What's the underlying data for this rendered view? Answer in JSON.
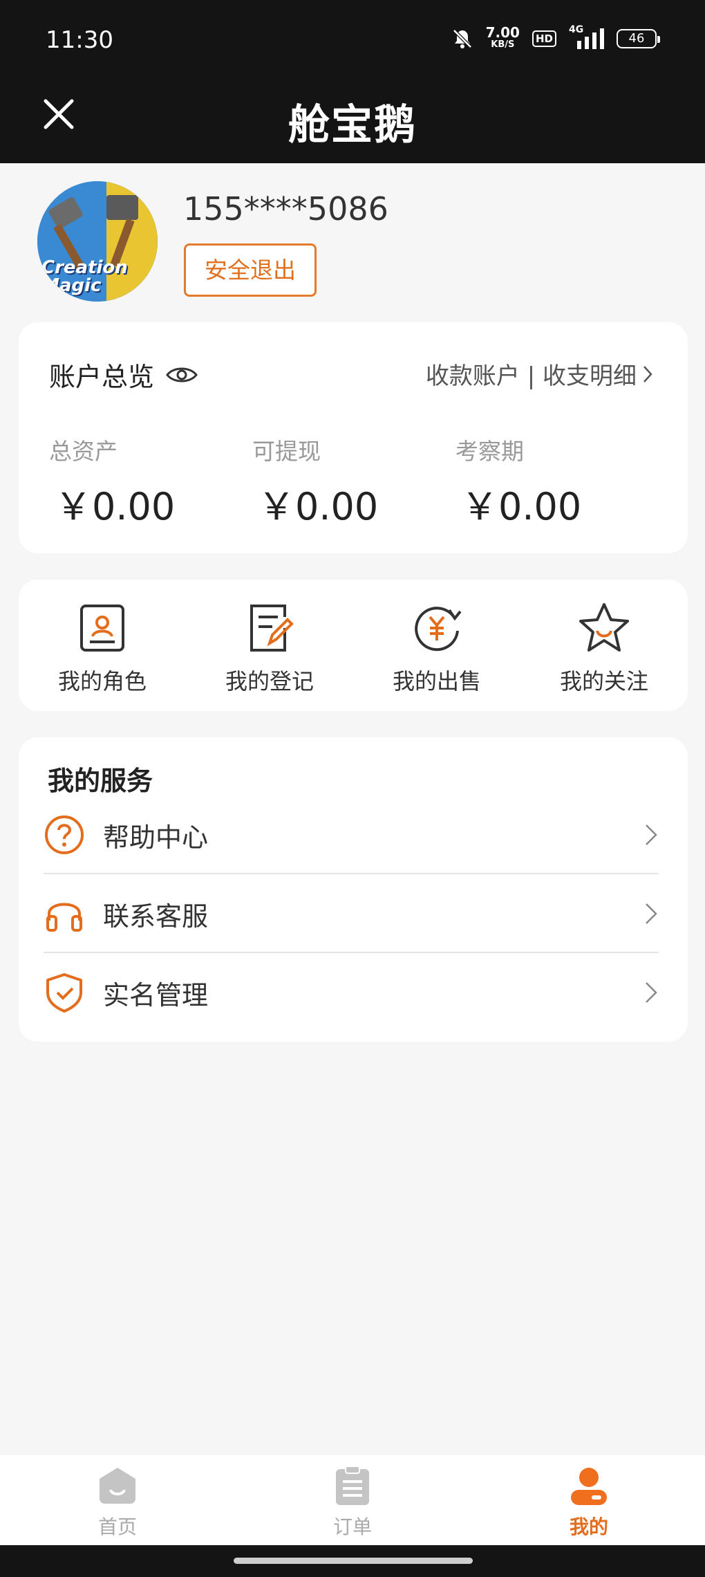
{
  "status_bar": {
    "time": "11:30",
    "net_speed": "7.00",
    "net_unit": "KB/S",
    "hd": "HD",
    "network": "4G",
    "battery": "46"
  },
  "header": {
    "title": "舱宝鹅",
    "close_icon": "close-icon"
  },
  "profile": {
    "avatar_text": "Creation Magic",
    "phone": "155****5086",
    "logout_label": "安全退出"
  },
  "account": {
    "title": "账户总览",
    "links": "收款账户 | 收支明细",
    "stats": [
      {
        "label": "总资产",
        "value": "￥0.00"
      },
      {
        "label": "可提现",
        "value": "￥0.00"
      },
      {
        "label": "考察期",
        "value": "￥0.00"
      }
    ]
  },
  "shortcuts": [
    {
      "label": "我的角色",
      "icon": "role-icon"
    },
    {
      "label": "我的登记",
      "icon": "register-icon"
    },
    {
      "label": "我的出售",
      "icon": "sale-icon"
    },
    {
      "label": "我的关注",
      "icon": "star-icon"
    }
  ],
  "services": {
    "title": "我的服务",
    "items": [
      {
        "label": "帮助中心",
        "icon": "help-icon"
      },
      {
        "label": "联系客服",
        "icon": "headset-icon"
      },
      {
        "label": "实名管理",
        "icon": "shield-check-icon"
      }
    ]
  },
  "tabbar": {
    "items": [
      {
        "label": "首页",
        "icon": "home-icon"
      },
      {
        "label": "订单",
        "icon": "order-icon"
      },
      {
        "label": "我的",
        "icon": "user-icon"
      }
    ],
    "active_index": 2
  },
  "colors": {
    "accent": "#e36d1c",
    "header_bg": "#141414",
    "page_bg": "#f6f6f6"
  }
}
